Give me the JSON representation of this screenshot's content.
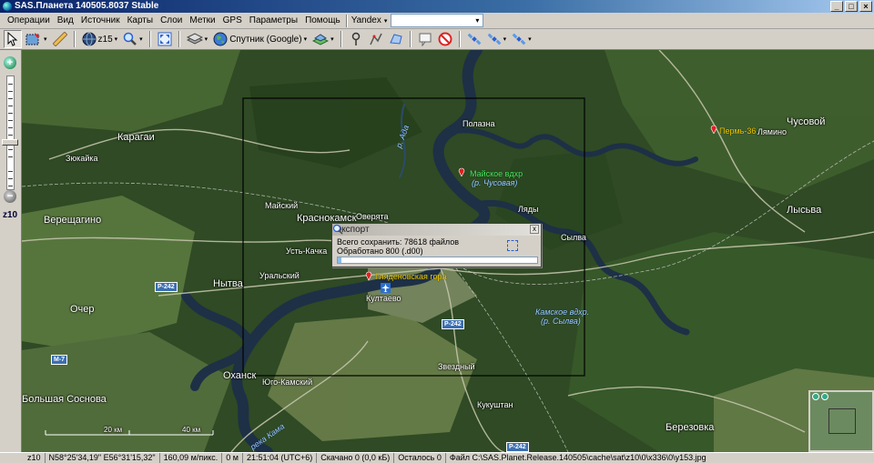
{
  "window": {
    "title": "SAS.Планета 140505.8037 Stable",
    "btn_min": "_",
    "btn_max": "□",
    "btn_close": "×"
  },
  "menu": {
    "items": [
      "Операции",
      "Вид",
      "Источник",
      "Карты",
      "Слои",
      "Метки",
      "GPS",
      "Параметры",
      "Помощь"
    ],
    "search_engine": "Yandex",
    "search_value": "",
    "dropdown_glyph": "▾"
  },
  "toolbar": {
    "zoom_level": "z15",
    "map_source": "Спутник (Google)",
    "caret": "▾"
  },
  "zoom": {
    "current": "z10",
    "in_glyph": "+",
    "out_glyph": "−",
    "slider_fraction": 0.76
  },
  "export_dialog": {
    "title": "Экспорт",
    "close": "x",
    "total": "Всего сохранить: 78618 файлов",
    "processed": "Обработано 800  (.d00)",
    "progress": 0.01
  },
  "map_labels": {
    "karagay": "Карагаи",
    "zyukaika": "Зюкайка",
    "vereshchagino": "Верещагино",
    "ocher": "Очер",
    "nytva": "Нытва",
    "okhansk": "Оханск",
    "bolshaya_sosnova": "Большая Соснова",
    "krasnokamsk": "Краснокамск",
    "mayskiy": "Майский",
    "overyata": "Оверята",
    "ust_kachka": "Усть-Качка",
    "uralskiy": "Уральский",
    "kultaevo": "Култаево",
    "zvezdny": "Звездный",
    "yugo_kamskiy": "Юго-Камский",
    "kukushtan": "Кукуштан",
    "berezovka": "Березовка",
    "lysva": "Лысьва",
    "chusovoy": "Чусовой",
    "lyamino": "Лямино",
    "polazna": "Полазна",
    "lyady": "Ляды",
    "sylva": "Сылва",
    "perm36": "Пермь-36",
    "mayskoe_vdhr": "Майское вдхр",
    "mayskoe_vdhr_sub": "(р. Чусовая)",
    "glyadenovskaya": "Гляденовская гора",
    "kamskoe_vdhr": "Камское вдхр.",
    "kamskoe_vdhr_sub": "(р. Сылва)",
    "r_kama": "река Кама",
    "r_ada": "р. Ада",
    "road_p242": "Р-242",
    "road_m7": "М-7",
    "scale_20": "20 км",
    "scale_40": "40 км"
  },
  "status": {
    "zoom": "z10",
    "coords": "N58°25'34,19\" E56°31'15,32\"",
    "resolution": "160,09 м/пикс.",
    "distance": "0 м",
    "time": "21:51:04 (UTC+6)",
    "downloaded": "Скачано 0 (0,0 кБ)",
    "remaining": "Осталось 0",
    "file": "Файл C:\\SAS.Planet.Release.140505\\cache\\sat\\z10\\0\\x336\\0\\y153.jpg"
  },
  "colors": {
    "map_base": "#2c4420",
    "road": "#c9c9b0",
    "river": "#1c3048",
    "selection": "#000000",
    "titlebar": "#0a246a",
    "progress": "#8bbbe8"
  }
}
